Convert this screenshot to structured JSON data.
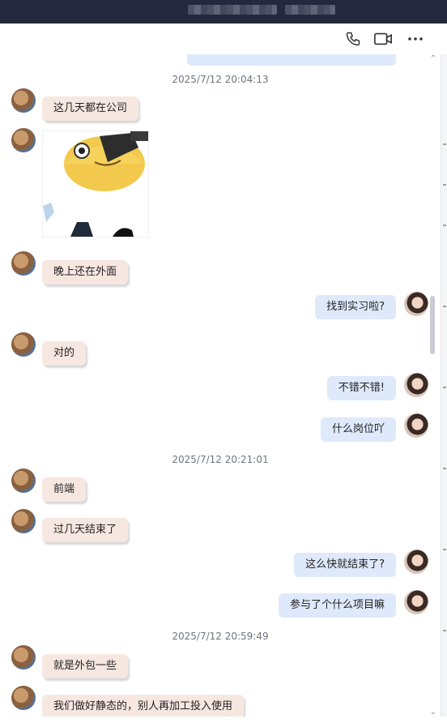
{
  "toolbar": {
    "call_icon": "phone-icon",
    "video_icon": "video-camera-icon",
    "more_icon": "more-horizontal-icon"
  },
  "colors": {
    "titlebar": "#24283d",
    "other_bubble": "#f7e7e1",
    "my_bubble": "#dfe9fc",
    "timestamp": "#6f7480"
  },
  "timestamps": [
    "2025/7/12 20:04:13",
    "2025/7/12 20:21:01",
    "2025/7/12 20:59:49"
  ],
  "messages": [
    {
      "sender": "other",
      "text": "这几天都在公司"
    },
    {
      "sender": "other",
      "type": "sticker",
      "text": ""
    },
    {
      "sender": "other",
      "text": "晚上还在外面"
    },
    {
      "sender": "me",
      "text": "找到实习啦?"
    },
    {
      "sender": "other",
      "text": "对的"
    },
    {
      "sender": "me",
      "text": "不错不错!"
    },
    {
      "sender": "me",
      "text": "什么岗位吖"
    },
    {
      "sender": "other",
      "text": "前端"
    },
    {
      "sender": "other",
      "text": "过几天结束了"
    },
    {
      "sender": "me",
      "text": "这么快就结束了?"
    },
    {
      "sender": "me",
      "text": "参与了个什么项目嘛"
    },
    {
      "sender": "other",
      "text": "就是外包一些"
    },
    {
      "sender": "other",
      "text": "我们做好静态的，别人再加工投入使用"
    }
  ]
}
